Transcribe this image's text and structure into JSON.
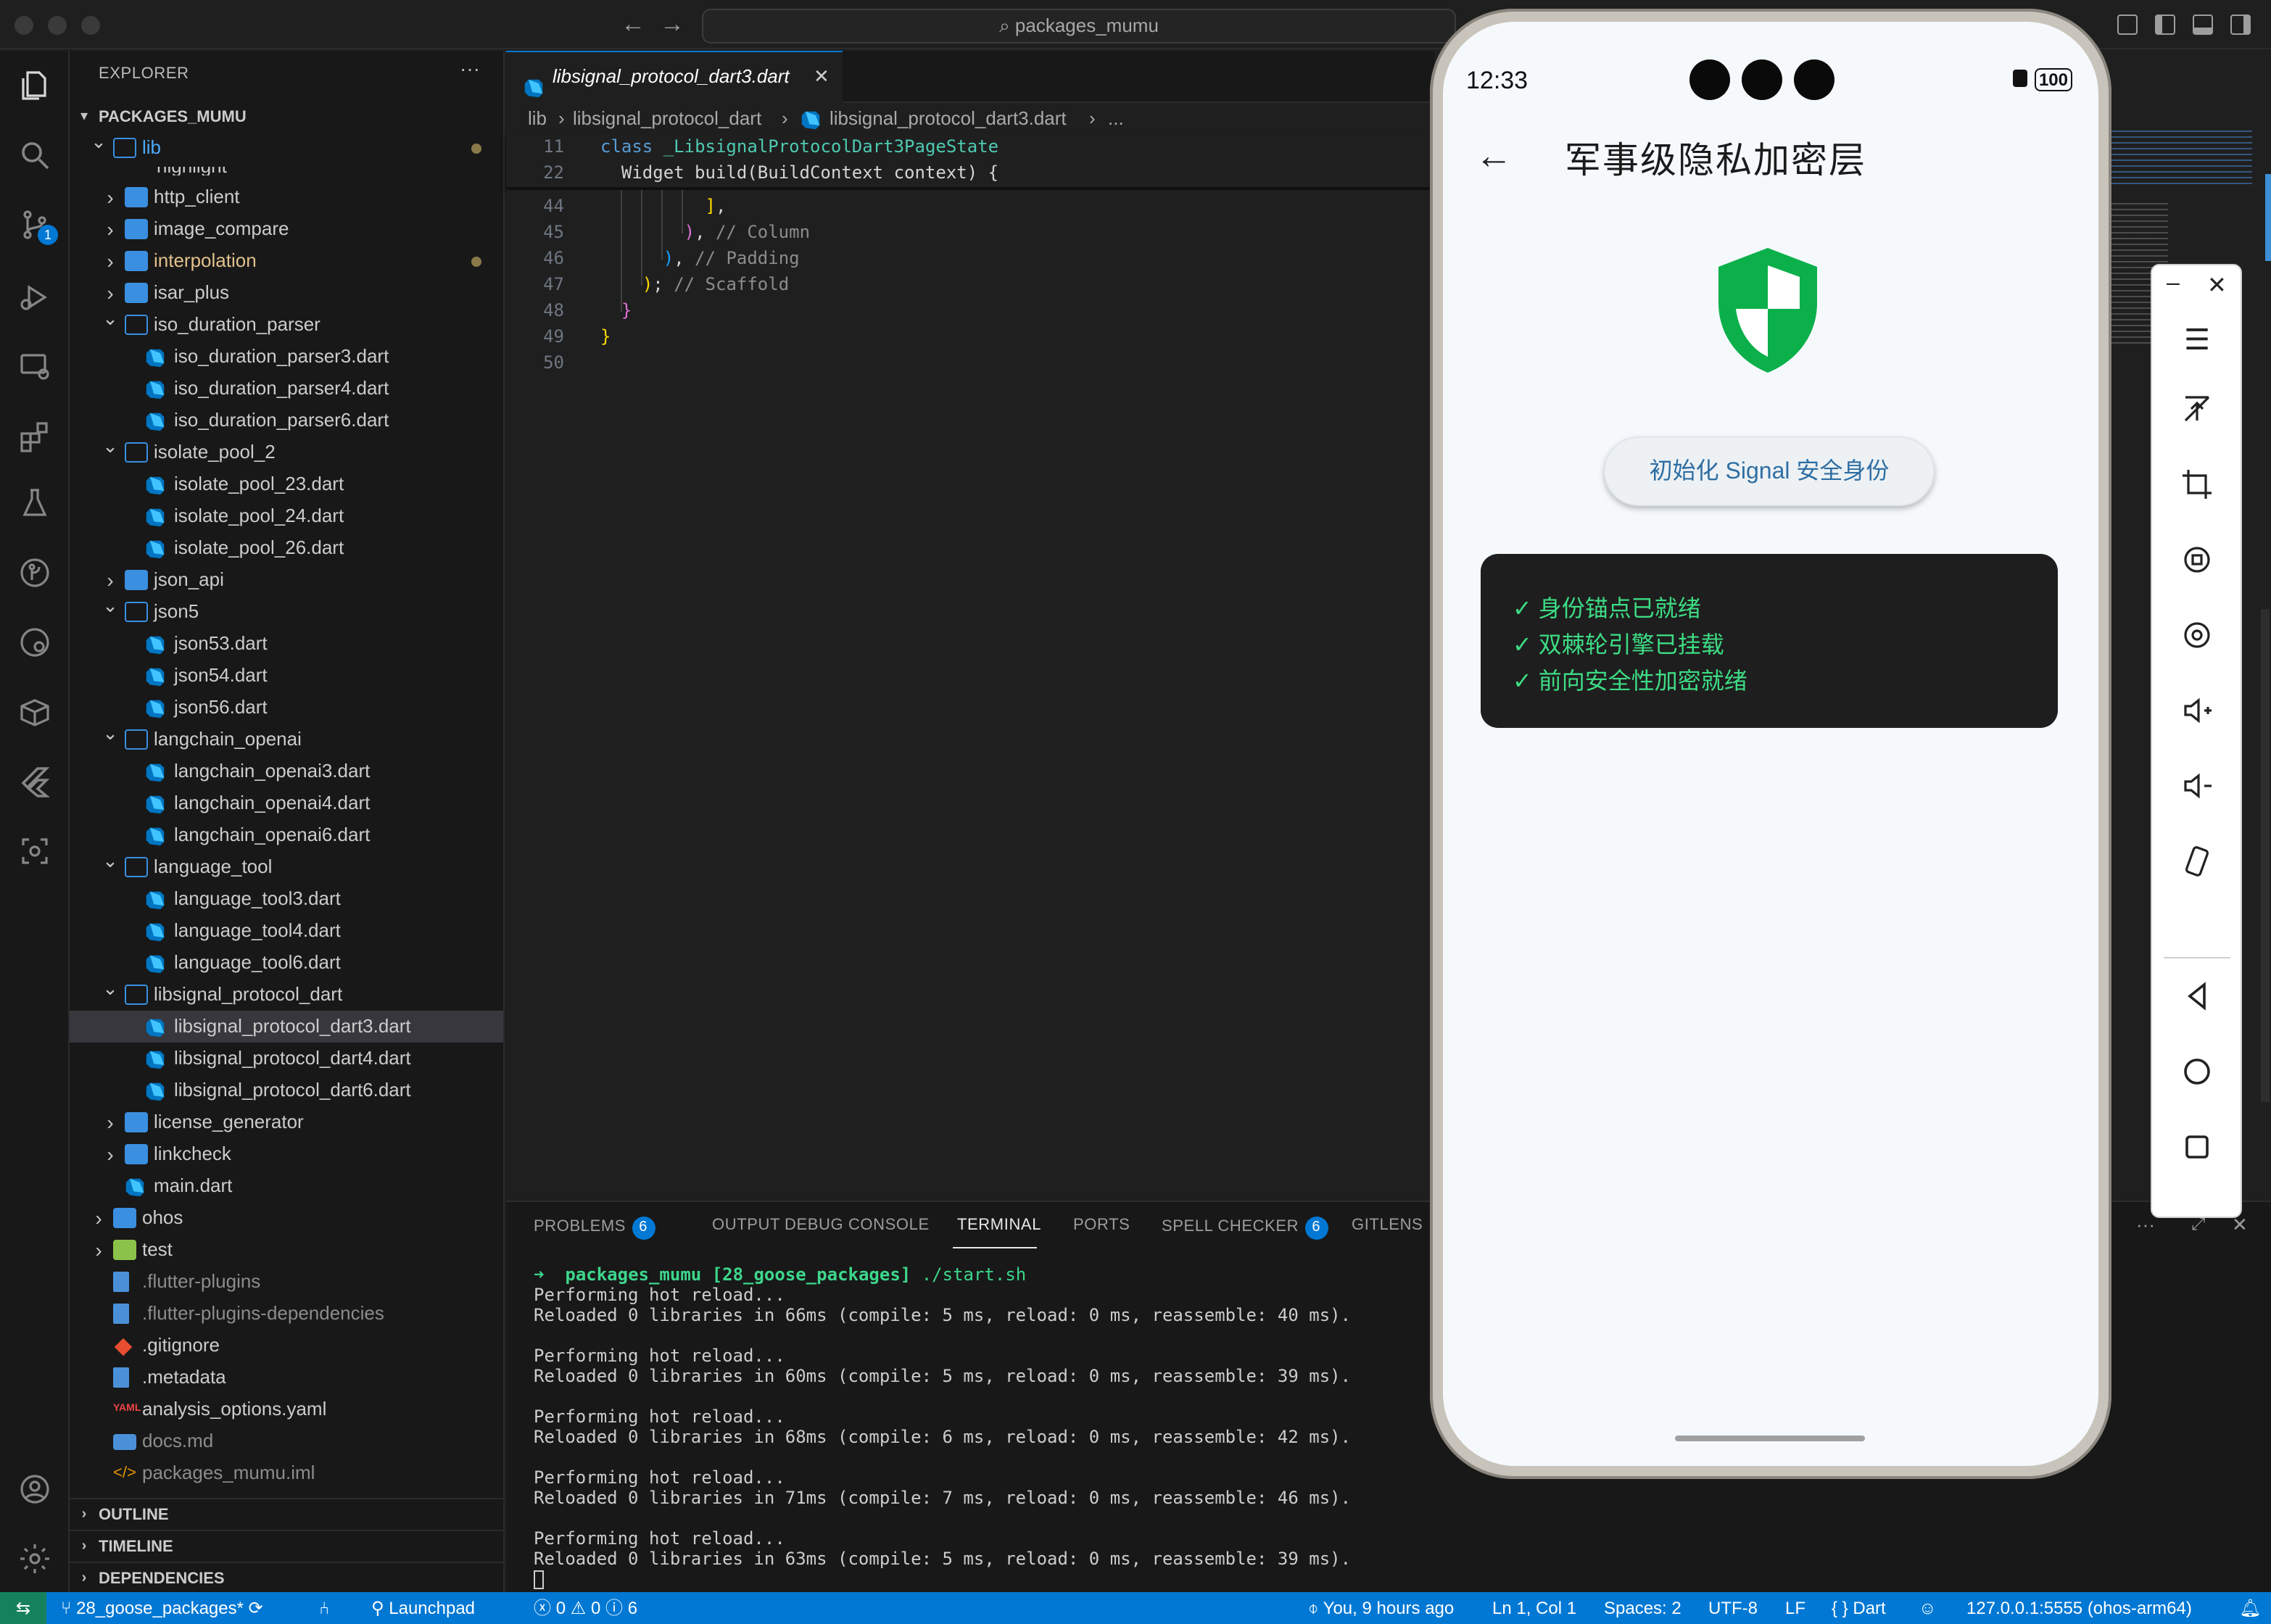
{
  "title_bar": {
    "search_text": "packages_mumu"
  },
  "explorer": {
    "title": "EXPLORER",
    "root": "PACKAGES_MUMU",
    "partial_item": "highlight",
    "items": [
      {
        "label": "lib",
        "kind": "folder-open",
        "depth": 0
      },
      {
        "label": "http_client",
        "kind": "folder",
        "depth": 1
      },
      {
        "label": "image_compare",
        "kind": "folder",
        "depth": 1
      },
      {
        "label": "interpolation",
        "kind": "folder",
        "depth": 1
      },
      {
        "label": "isar_plus",
        "kind": "folder",
        "depth": 1
      },
      {
        "label": "iso_duration_parser",
        "kind": "folder-open",
        "depth": 1
      },
      {
        "label": "iso_duration_parser3.dart",
        "kind": "dart",
        "depth": 2
      },
      {
        "label": "iso_duration_parser4.dart",
        "kind": "dart",
        "depth": 2
      },
      {
        "label": "iso_duration_parser6.dart",
        "kind": "dart",
        "depth": 2
      },
      {
        "label": "isolate_pool_2",
        "kind": "folder-open",
        "depth": 1
      },
      {
        "label": "isolate_pool_23.dart",
        "kind": "dart",
        "depth": 2
      },
      {
        "label": "isolate_pool_24.dart",
        "kind": "dart",
        "depth": 2
      },
      {
        "label": "isolate_pool_26.dart",
        "kind": "dart",
        "depth": 2
      },
      {
        "label": "json_api",
        "kind": "folder",
        "depth": 1
      },
      {
        "label": "json5",
        "kind": "folder-open",
        "depth": 1
      },
      {
        "label": "json53.dart",
        "kind": "dart",
        "depth": 2
      },
      {
        "label": "json54.dart",
        "kind": "dart",
        "depth": 2
      },
      {
        "label": "json56.dart",
        "kind": "dart",
        "depth": 2
      },
      {
        "label": "langchain_openai",
        "kind": "folder-open",
        "depth": 1
      },
      {
        "label": "langchain_openai3.dart",
        "kind": "dart",
        "depth": 2
      },
      {
        "label": "langchain_openai4.dart",
        "kind": "dart",
        "depth": 2
      },
      {
        "label": "langchain_openai6.dart",
        "kind": "dart",
        "depth": 2
      },
      {
        "label": "language_tool",
        "kind": "folder-open",
        "depth": 1
      },
      {
        "label": "language_tool3.dart",
        "kind": "dart",
        "depth": 2
      },
      {
        "label": "language_tool4.dart",
        "kind": "dart",
        "depth": 2
      },
      {
        "label": "language_tool6.dart",
        "kind": "dart",
        "depth": 2
      },
      {
        "label": "libsignal_protocol_dart",
        "kind": "folder-open",
        "depth": 1
      },
      {
        "label": "libsignal_protocol_dart3.dart",
        "kind": "dart",
        "depth": 2
      },
      {
        "label": "libsignal_protocol_dart4.dart",
        "kind": "dart",
        "depth": 2
      },
      {
        "label": "libsignal_protocol_dart6.dart",
        "kind": "dart",
        "depth": 2
      },
      {
        "label": "license_generator",
        "kind": "folder",
        "depth": 1
      },
      {
        "label": "linkcheck",
        "kind": "folder",
        "depth": 1
      },
      {
        "label": "main.dart",
        "kind": "dart",
        "depth": 1
      },
      {
        "label": "ohos",
        "kind": "folder",
        "depth": 0
      },
      {
        "label": "test",
        "kind": "folder-test",
        "depth": 0
      },
      {
        "label": ".flutter-plugins",
        "kind": "file",
        "depth": 0
      },
      {
        "label": ".flutter-plugins-dependencies",
        "kind": "file",
        "depth": 0
      },
      {
        "label": ".gitignore",
        "kind": "git",
        "depth": 0
      },
      {
        "label": ".metadata",
        "kind": "file",
        "depth": 0
      },
      {
        "label": "analysis_options.yaml",
        "kind": "yaml",
        "depth": 0
      },
      {
        "label": "docs.md",
        "kind": "md",
        "depth": 0
      },
      {
        "label": "packages_mumu.iml",
        "kind": "xml",
        "depth": 0
      }
    ],
    "sections": [
      "OUTLINE",
      "TIMELINE",
      "DEPENDENCIES"
    ]
  },
  "editor": {
    "tab": "libsignal_protocol_dart3.dart",
    "breadcrumb": [
      "lib",
      "libsignal_protocol_dart",
      "libsignal_protocol_dart3.dart",
      "..."
    ],
    "sticky": [
      {
        "num": "11",
        "code": "class _LibsignalProtocolDart3PageState"
      },
      {
        "num": "22",
        "code": "  Widget build(BuildContext context) {"
      }
    ],
    "lines": [
      {
        "num": "44",
        "code": "          ],"
      },
      {
        "num": "45",
        "code": "        ), // Column"
      },
      {
        "num": "46",
        "code": "      ), // Padding"
      },
      {
        "num": "47",
        "code": "    ); // Scaffold"
      },
      {
        "num": "48",
        "code": "  }"
      },
      {
        "num": "49",
        "code": "}"
      },
      {
        "num": "50",
        "code": ""
      }
    ]
  },
  "panel": {
    "tabs": [
      {
        "label": "PROBLEMS",
        "badge": "6"
      },
      {
        "label": "OUTPUT",
        "badge": ""
      },
      {
        "label": "DEBUG CONSOLE",
        "badge": ""
      },
      {
        "label": "TERMINAL",
        "badge": ""
      },
      {
        "label": "PORTS",
        "badge": ""
      },
      {
        "label": "SPELL CHECKER",
        "badge": "6"
      },
      {
        "label": "GITLENS",
        "badge": ""
      }
    ],
    "active_tab": "TERMINAL",
    "prompt_dir": "packages_mumu",
    "prompt_branch": "[28_goose_packages]",
    "prompt_cmd": "./start.sh",
    "reloads": [
      {
        "a": "Performing hot reload...",
        "b": "Reloaded 0 libraries in 66ms (compile: 5 ms, reload: 0 ms, reassemble: 40 ms)."
      },
      {
        "a": "Performing hot reload...",
        "b": "Reloaded 0 libraries in 60ms (compile: 5 ms, reload: 0 ms, reassemble: 39 ms)."
      },
      {
        "a": "Performing hot reload...",
        "b": "Reloaded 0 libraries in 68ms (compile: 6 ms, reload: 0 ms, reassemble: 42 ms)."
      },
      {
        "a": "Performing hot reload...",
        "b": "Reloaded 0 libraries in 71ms (compile: 7 ms, reload: 0 ms, reassemble: 46 ms)."
      },
      {
        "a": "Performing hot reload...",
        "b": "Reloaded 0 libraries in 63ms (compile: 5 ms, reload: 0 ms, reassemble: 39 ms)."
      }
    ]
  },
  "status_bar": {
    "branch": "28_goose_packages*",
    "launchpad": "Launchpad",
    "errors": "0",
    "warnings": "0",
    "info": "6",
    "blame": "You, 9 hours ago",
    "position": "Ln 1, Col 1",
    "spaces": "Spaces: 2",
    "encoding": "UTF-8",
    "eol": "LF",
    "language": "Dart",
    "device": "127.0.0.1:5555 (ohos-arm64)"
  },
  "phone": {
    "time": "12:33",
    "battery": "100",
    "title": "军事级隐私加密层",
    "button": "初始化 Signal 安全身份",
    "status_lines": [
      "✓  身份锚点已就绪",
      "✓  双棘轮引擎已挂载",
      "✓  前向安全性加密就绪"
    ],
    "colors": {
      "shield": "#0bb04a",
      "check": "#3ddc84",
      "button_text": "#2e6ea3"
    }
  },
  "colors": {
    "accent": "#0078d4",
    "folder": "#3a8fe0"
  }
}
